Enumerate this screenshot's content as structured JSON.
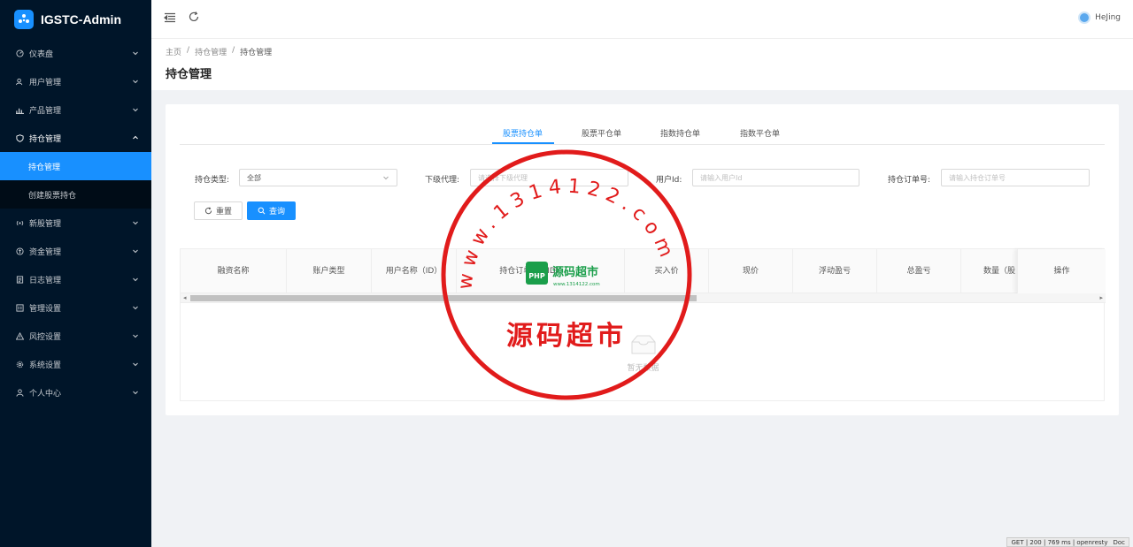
{
  "app": {
    "title": "IGSTC-Admin"
  },
  "sidebar": {
    "items": [
      {
        "label": "仪表盘",
        "icon": "dashboard-icon"
      },
      {
        "label": "用户管理",
        "icon": "users-icon"
      },
      {
        "label": "产品管理",
        "icon": "chart-icon"
      },
      {
        "label": "持仓管理",
        "icon": "shield-icon"
      },
      {
        "label": "新股管理",
        "icon": "broadcast-icon"
      },
      {
        "label": "资金管理",
        "icon": "coin-icon"
      },
      {
        "label": "日志管理",
        "icon": "log-icon"
      },
      {
        "label": "管理设置",
        "icon": "settings-box-icon"
      },
      {
        "label": "风控设置",
        "icon": "warning-icon"
      },
      {
        "label": "系统设置",
        "icon": "gear-icon"
      },
      {
        "label": "个人中心",
        "icon": "user-icon"
      }
    ],
    "submenu": [
      {
        "label": "持仓管理"
      },
      {
        "label": "创建股票持仓"
      }
    ]
  },
  "header": {
    "user_name": "HeJing"
  },
  "breadcrumb": {
    "home": "主页",
    "level1": "持仓管理",
    "current": "持仓管理",
    "sep": "/"
  },
  "page": {
    "title": "持仓管理"
  },
  "tabs": [
    {
      "label": "股票持仓单"
    },
    {
      "label": "股票平仓单"
    },
    {
      "label": "指数持仓单"
    },
    {
      "label": "指数平仓单"
    }
  ],
  "filters": {
    "type_label": "持仓类型:",
    "type_value": "全部",
    "agent_label": "下级代理:",
    "agent_placeholder": "请选择下级代理",
    "user_label": "用户Id:",
    "user_placeholder": "请输入用户Id",
    "order_label": "持仓订单号:",
    "order_placeholder": "请输入持仓订单号",
    "reset_label": "重置",
    "search_label": "查询"
  },
  "table": {
    "columns": [
      "融资名称",
      "账户类型",
      "用户名称（ID）",
      "持仓订单号（ID）",
      "买入价",
      "现价",
      "浮动盈亏",
      "总盈亏",
      "数量（股"
    ],
    "op_label": "操作",
    "empty_text": "暂无数据"
  },
  "watermark": {
    "url_text": "www.1314122.com",
    "name_text": "源码超市",
    "logo_text": "源码超市",
    "logo_sub": "www.1314122.com",
    "logo_badge": "PHP"
  },
  "status_bar": {
    "text": "GET | 200 | 769 ms | openresty",
    "right_text": "Doc"
  },
  "colors": {
    "sidebar_bg": "#001529",
    "accent": "#1890ff",
    "stamp": "#e11b1b"
  }
}
